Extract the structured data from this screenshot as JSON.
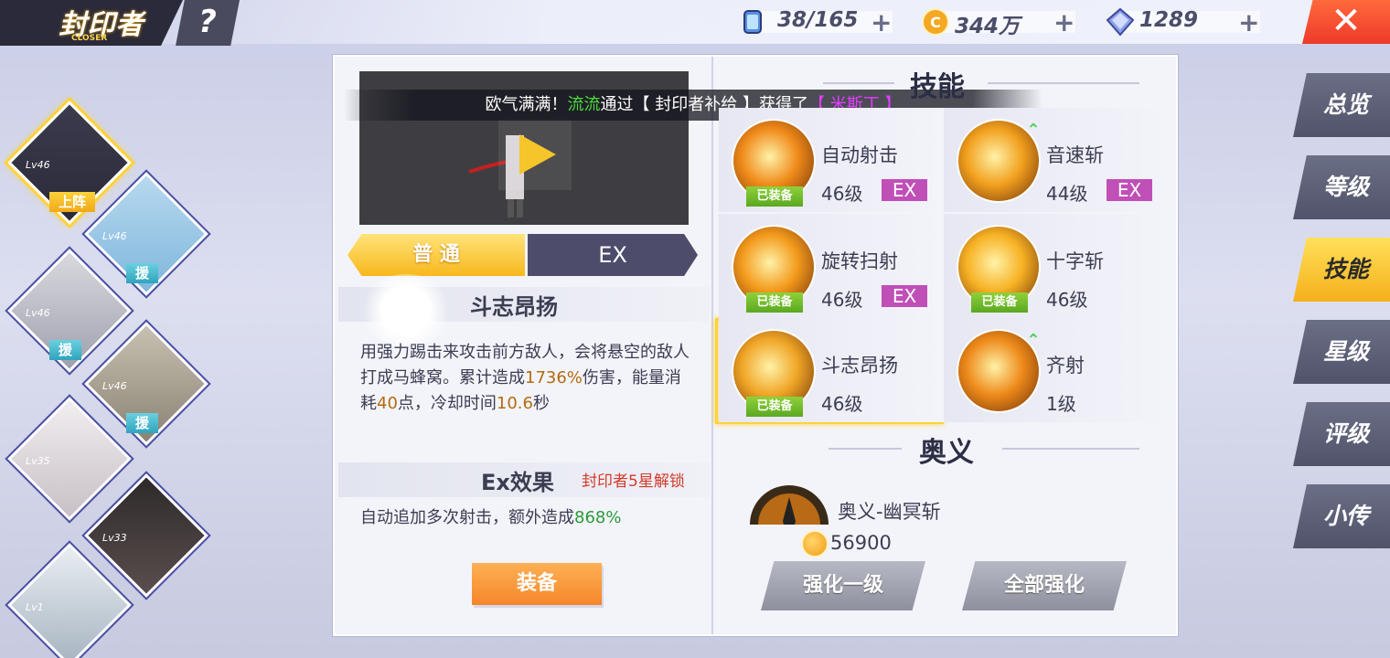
{
  "header": {
    "title": "封印者",
    "subtitle": "CLOSER",
    "help_label": "?",
    "close_label": "✕",
    "resources": [
      {
        "name": "stamina",
        "value": "38/165",
        "icon": "energy-cell-icon",
        "plus": "+"
      },
      {
        "name": "gold",
        "value": "344万",
        "icon": "coin-icon",
        "plus": "+"
      },
      {
        "name": "diamond",
        "value": "1289",
        "icon": "diamond-icon",
        "plus": "+"
      }
    ]
  },
  "characters": [
    {
      "level": "Lv46",
      "tag": "上阵",
      "colors": [
        "#3b3b4e",
        "#2a2a38"
      ]
    },
    {
      "level": "Lv46",
      "tag": "援",
      "colors": [
        "#b7d9ef",
        "#7fb6dc"
      ]
    },
    {
      "level": "Lv46",
      "tag": "援",
      "colors": [
        "#d9d9df",
        "#9ea0ad"
      ]
    },
    {
      "level": "Lv46",
      "tag": "援",
      "colors": [
        "#c8c0b0",
        "#8a8272"
      ]
    },
    {
      "level": "Lv35",
      "tag": "",
      "colors": [
        "#f1eef0",
        "#c8c0c6"
      ]
    },
    {
      "level": "Lv33",
      "tag": "",
      "colors": [
        "#2e2a2a",
        "#5a4e4e"
      ]
    },
    {
      "level": "Lv1",
      "tag": "",
      "colors": [
        "#e9eef3",
        "#a7b4c0"
      ]
    }
  ],
  "notice": {
    "prefix": "欧气满满！",
    "player": "流流",
    "middle": "通过【 封印者补给 】获得了",
    "item": "【 米斯丁 】"
  },
  "tabs": {
    "normal": "普 通",
    "ex": "EX"
  },
  "selected_skill": {
    "name": "斗志昂扬",
    "desc_parts": [
      "用强力踢击来攻击前方敌人，会将悬空的敌人打成马蜂窝。累计造成",
      "1736%",
      "伤害，能量消耗",
      "40",
      "点，冷却时间",
      "10.6",
      "秒"
    ],
    "ex_title": "Ex效果",
    "ex_lock": "封印者5星解锁",
    "ex_desc_prefix": "自动追加多次射击，额外造成",
    "ex_desc_value": "868%",
    "equip_label": "装备"
  },
  "skills_title": "技能",
  "skills": [
    {
      "name": "自动射击",
      "level": "46级",
      "equipped": "已装备",
      "ex": "EX",
      "upgradable": false,
      "color": "#f08a1a"
    },
    {
      "name": "音速斩",
      "level": "44级",
      "equipped": "",
      "ex": "EX",
      "upgradable": true,
      "color": "#f2a01e"
    },
    {
      "name": "旋转扫射",
      "level": "46级",
      "equipped": "已装备",
      "ex": "EX",
      "upgradable": false,
      "color": "#f39a1c"
    },
    {
      "name": "十字斩",
      "level": "46级",
      "equipped": "已装备",
      "ex": "",
      "upgradable": false,
      "color": "#f7b224"
    },
    {
      "name": "斗志昂扬",
      "level": "46级",
      "equipped": "已装备",
      "ex": "",
      "upgradable": false,
      "color": "#f0a526"
    },
    {
      "name": "齐射",
      "level": "1级",
      "equipped": "",
      "ex": "",
      "upgradable": true,
      "color": "#ee8a1a"
    }
  ],
  "ultimate": {
    "section_title": "奥义",
    "name": "奥义-幽冥斩",
    "cost": "56900",
    "upgrade_one": "强化一级",
    "upgrade_all": "全部强化"
  },
  "nav": [
    {
      "label": "总览",
      "active": false
    },
    {
      "label": "等级",
      "active": false
    },
    {
      "label": "技能",
      "active": true
    },
    {
      "label": "星级",
      "active": false
    },
    {
      "label": "评级",
      "active": false
    },
    {
      "label": "小传",
      "active": false
    }
  ]
}
